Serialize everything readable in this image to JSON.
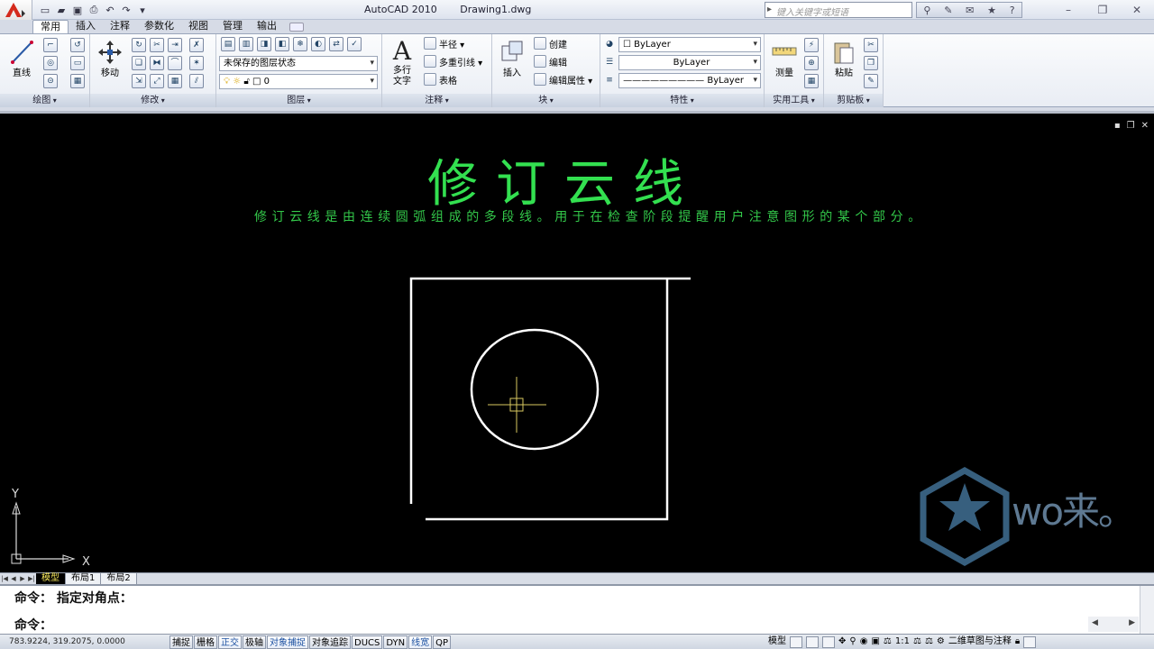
{
  "titlebar": {
    "app_name": "AutoCAD 2010",
    "document": "Drawing1.dwg",
    "search_placeholder": "键入关键字或短语"
  },
  "ribbon_tabs": [
    "常用",
    "插入",
    "注释",
    "参数化",
    "视图",
    "管理",
    "输出"
  ],
  "panels": {
    "draw": {
      "label": "绘图",
      "line_label": "直线"
    },
    "modify": {
      "label": "修改",
      "move_label": "移动"
    },
    "layers": {
      "label": "图层",
      "layer_state": "未保存的图层状态",
      "current_layer": "0"
    },
    "annotation": {
      "label": "注释",
      "mtext_label_1": "多行",
      "mtext_label_2": "文字",
      "radius": "半径",
      "mleader": "多重引线",
      "table": "表格"
    },
    "block": {
      "label": "块",
      "insert": "插入",
      "create": "创建",
      "edit": "编辑",
      "edit_attr": "编辑属性"
    },
    "properties": {
      "label": "特性",
      "color": "ByLayer",
      "linetype": "ByLayer",
      "lineweight": "ByLayer"
    },
    "utilities": {
      "label": "实用工具",
      "measure": "测量"
    },
    "clipboard": {
      "label": "剪贴板",
      "paste": "粘贴"
    }
  },
  "drawing": {
    "title": "修订云线",
    "subtitle": "修订云线是由连续圆弧组成的多段线。用于在检查阶段提醒用户注意图形的某个部分。",
    "ucs_x": "X",
    "ucs_y": "Y",
    "watermark": "wo来。"
  },
  "layout_tabs": [
    "模型",
    "布局1",
    "布局2"
  ],
  "command": {
    "history": "命令： 指定对角点：",
    "prompt": "命令："
  },
  "status": {
    "coordinates": "783.9224, 319.2075, 0.0000",
    "toggles": [
      "捕捉",
      "栅格",
      "正交",
      "极轴",
      "对象捕捉",
      "对象追踪",
      "DUCS",
      "DYN",
      "线宽",
      "QP"
    ],
    "active_toggles": [
      "正交",
      "对象捕捉",
      "线宽"
    ],
    "model": "模型",
    "scale": "1:1",
    "workspace": "二维草图与注释"
  },
  "colors": {
    "canvas": "#000000",
    "title_text": "#33e050",
    "geometry": "#ffffff",
    "crosshair": "#d8c860"
  }
}
